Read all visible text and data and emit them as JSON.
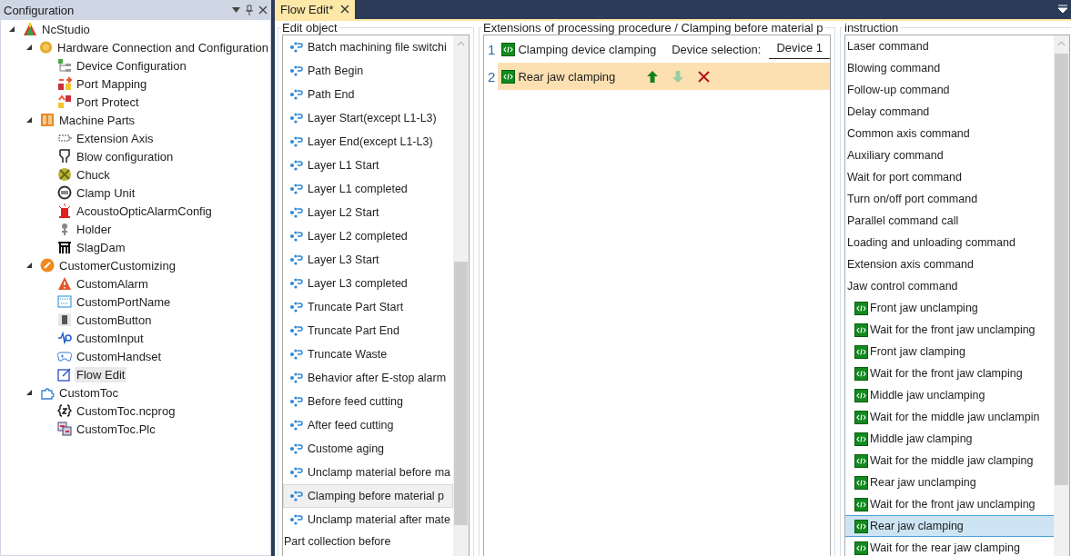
{
  "config_panel": {
    "title": "Configuration",
    "tree": [
      {
        "label": "NcStudio",
        "expanded": true,
        "selected": false,
        "children": [
          {
            "label": "Hardware Connection and Configuration",
            "expanded": true,
            "selected": false,
            "children": [
              {
                "label": "Device Configuration",
                "selected": false
              },
              {
                "label": "Port Mapping",
                "selected": false
              },
              {
                "label": "Port Protect",
                "selected": false
              }
            ]
          },
          {
            "label": "Machine Parts",
            "expanded": true,
            "selected": false,
            "children": [
              {
                "label": "Extension Axis",
                "selected": false
              },
              {
                "label": "Blow configuration",
                "selected": false
              },
              {
                "label": "Chuck",
                "selected": false
              },
              {
                "label": "Clamp Unit",
                "selected": false
              },
              {
                "label": "AcoustoOpticAlarmConfig",
                "selected": false
              },
              {
                "label": "Holder",
                "selected": false
              },
              {
                "label": "SlagDam",
                "selected": false
              }
            ]
          },
          {
            "label": "CustomerCustomizing",
            "expanded": true,
            "selected": false,
            "children": [
              {
                "label": "CustomAlarm",
                "selected": false
              },
              {
                "label": "CustomPortName",
                "selected": false
              },
              {
                "label": "CustomButton",
                "selected": false
              },
              {
                "label": "CustomInput",
                "selected": false
              },
              {
                "label": "CustomHandset",
                "selected": false
              },
              {
                "label": "Flow Edit",
                "selected": true
              }
            ]
          },
          {
            "label": "CustomToc",
            "expanded": true,
            "selected": false,
            "children": [
              {
                "label": "CustomToc.ncprog",
                "selected": false
              },
              {
                "label": "CustomToc.Plc",
                "selected": false
              }
            ]
          }
        ]
      }
    ]
  },
  "tabs": [
    {
      "label": "Flow Edit*",
      "selected": true
    }
  ],
  "edit_object": {
    "title": "Edit object",
    "items": [
      {
        "kind": "step",
        "label": "Batch machining file switchi",
        "selected": false
      },
      {
        "kind": "step",
        "label": "Path Begin",
        "selected": false
      },
      {
        "kind": "step",
        "label": "Path End",
        "selected": false
      },
      {
        "kind": "step",
        "label": "Layer Start(except L1-L3)",
        "selected": false
      },
      {
        "kind": "step",
        "label": "Layer End(except L1-L3)",
        "selected": false
      },
      {
        "kind": "step",
        "label": "Layer L1 Start",
        "selected": false
      },
      {
        "kind": "step",
        "label": "Layer L1 completed",
        "selected": false
      },
      {
        "kind": "step",
        "label": "Layer L2 Start",
        "selected": false
      },
      {
        "kind": "step",
        "label": "Layer L2 completed",
        "selected": false
      },
      {
        "kind": "step",
        "label": "Layer L3 Start",
        "selected": false
      },
      {
        "kind": "step",
        "label": "Layer L3 completed",
        "selected": false
      },
      {
        "kind": "step",
        "label": "Truncate Part Start",
        "selected": false
      },
      {
        "kind": "step",
        "label": "Truncate Part End",
        "selected": false
      },
      {
        "kind": "step",
        "label": "Truncate Waste",
        "selected": false
      },
      {
        "kind": "step",
        "label": "Behavior after E-stop alarm",
        "selected": false
      },
      {
        "kind": "step",
        "label": "Before feed cutting",
        "selected": false
      },
      {
        "kind": "step",
        "label": "After feed cutting",
        "selected": false
      },
      {
        "kind": "step",
        "label": "Custome aging",
        "selected": false
      },
      {
        "kind": "step",
        "label": "Unclamp material before ma",
        "selected": false
      },
      {
        "kind": "step",
        "label": "Clamping before material p",
        "selected": true
      },
      {
        "kind": "step",
        "label": "Unclamp material after mate",
        "selected": false
      },
      {
        "kind": "group",
        "label": "Part collection before",
        "selected": false
      }
    ]
  },
  "flow": {
    "title": "Extensions of processing procedure / Clamping before material p",
    "rows": [
      {
        "number": "1",
        "label": "Clamping device clamping",
        "selected": false,
        "device_label": "Device selection:",
        "device": "Device 1"
      },
      {
        "number": "2",
        "label": "Rear jaw clamping",
        "selected": true,
        "up_disabled": false,
        "down_disabled": true
      }
    ]
  },
  "instruction": {
    "title": "instruction",
    "items": [
      {
        "label": "Laser command",
        "selected": false
      },
      {
        "label": "Blowing command",
        "selected": false
      },
      {
        "label": "Follow-up command",
        "selected": false
      },
      {
        "label": "Delay command",
        "selected": false
      },
      {
        "label": "Common axis command",
        "selected": false
      },
      {
        "label": "Auxiliary command",
        "selected": false
      },
      {
        "label": "Wait for port command",
        "selected": false
      },
      {
        "label": "Turn on/off port command",
        "selected": false
      },
      {
        "label": "Parallel command call",
        "selected": false
      },
      {
        "label": "Loading and unloading command",
        "selected": false
      },
      {
        "label": "Extension axis command",
        "selected": false
      },
      {
        "label": "Jaw control command",
        "selected": false,
        "children": [
          {
            "label": "Front jaw unclamping",
            "selected": false
          },
          {
            "label": "Wait for the front jaw unclamping",
            "selected": false
          },
          {
            "label": "Front jaw clamping",
            "selected": false
          },
          {
            "label": "Wait for the front jaw clamping",
            "selected": false
          },
          {
            "label": "Middle jaw unclamping",
            "selected": false
          },
          {
            "label": "Wait for the middle jaw unclampin",
            "selected": false
          },
          {
            "label": "Middle jaw clamping",
            "selected": false
          },
          {
            "label": "Wait for the middle jaw clamping",
            "selected": false
          },
          {
            "label": "Rear jaw unclamping",
            "selected": false
          },
          {
            "label": "Wait for the front jaw unclamping",
            "selected": false
          },
          {
            "label": "Rear jaw clamping",
            "selected": true
          },
          {
            "label": "Wait for the rear jaw clamping",
            "selected": false
          }
        ]
      }
    ]
  }
}
